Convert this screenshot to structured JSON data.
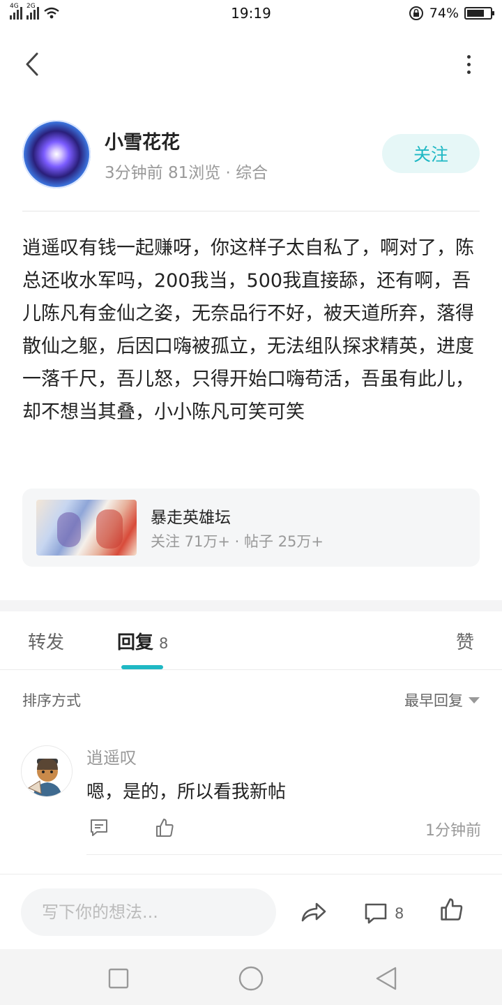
{
  "status_bar": {
    "time": "19:19",
    "battery": "74%",
    "battery_level": 0.74,
    "network_1": "4G",
    "network_2": "2G"
  },
  "nav": {
    "back_icon": "chevron-left-icon",
    "more_icon": "more-vertical-icon"
  },
  "author": {
    "name": "小雪花花",
    "meta": "3分钟前  81浏览 · 综合",
    "follow_label": "关注"
  },
  "post": {
    "body": "逍遥叹有钱一起赚呀，你这样子太自私了，啊对了，陈总还收水军吗，200我当，500我直接舔，还有啊，吾儿陈凡有金仙之姿，无奈品行不好，被天道所弃，落得散仙之躯，后因口嗨被孤立，无法组队探求精英，进度一落千尺，吾儿怒，只得开始口嗨苟活，吾虽有此儿，却不想当其叠，小小陈凡可笑可笑"
  },
  "forum": {
    "name": "暴走英雄坛",
    "stats": "关注 71万+ · 帖子 25万+"
  },
  "tabs": {
    "repost": "转发",
    "reply": "回复",
    "reply_count": "8",
    "like": "赞"
  },
  "sort": {
    "label": "排序方式",
    "selected": "最早回复"
  },
  "comments": [
    {
      "user": "逍遥叹",
      "text": "嗯，是的，所以看我新帖",
      "time": "1分钟前"
    }
  ],
  "bottom_bar": {
    "input_placeholder": "写下你的想法...",
    "comment_count": "8"
  },
  "colors": {
    "accent": "#1fb8c4",
    "follow_bg": "#e6f7f7",
    "muted_text": "#999999"
  }
}
